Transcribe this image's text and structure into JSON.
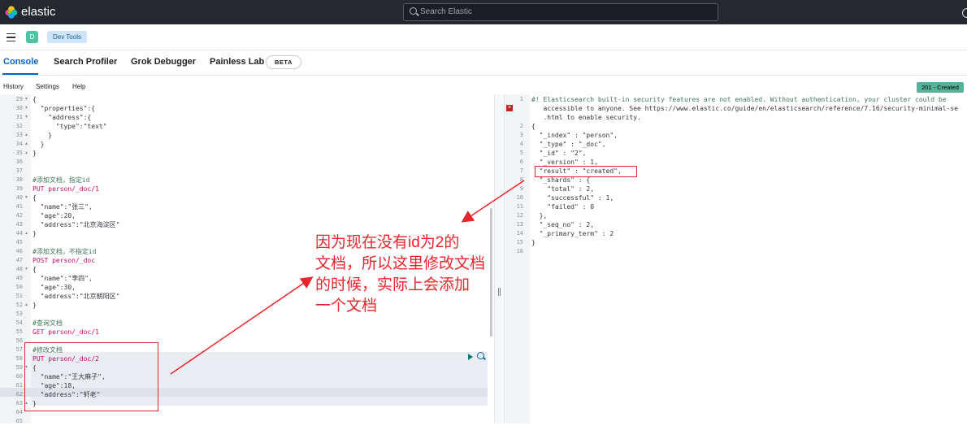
{
  "header": {
    "brand": "elastic",
    "search_placeholder": "Search Elastic",
    "space_initial": "D",
    "breadcrumb": "Dev Tools"
  },
  "tabs": [
    {
      "label": "Console",
      "active": true
    },
    {
      "label": "Search Profiler"
    },
    {
      "label": "Grok Debugger"
    },
    {
      "label": "Painless Lab"
    }
  ],
  "beta_badge": "BETA",
  "toolbar": {
    "history": "History",
    "settings": "Settings",
    "help": "Help"
  },
  "status_badge": "201 - Created",
  "colors": {
    "accent": "#0b64b8",
    "annotation": "#e8252c",
    "status": "#54b399"
  },
  "request_lines": [
    {
      "n": "29",
      "text": "{"
    },
    {
      "n": "30",
      "text": "  \"properties\":{"
    },
    {
      "n": "31",
      "text": "    \"address\":{"
    },
    {
      "n": "32",
      "text": "      \"type\":\"text\""
    },
    {
      "n": "33",
      "text": "    }"
    },
    {
      "n": "34",
      "text": "  }"
    },
    {
      "n": "35",
      "text": "}"
    },
    {
      "n": "36",
      "text": ""
    },
    {
      "n": "37",
      "text": ""
    },
    {
      "n": "38",
      "text": "#添加文档，指定id"
    },
    {
      "n": "39",
      "text": "PUT person/_doc/1"
    },
    {
      "n": "40",
      "text": "{"
    },
    {
      "n": "41",
      "text": "  \"name\":\"张三\","
    },
    {
      "n": "42",
      "text": "  \"age\":20,"
    },
    {
      "n": "43",
      "text": "  \"address\":\"北京海淀区\""
    },
    {
      "n": "44",
      "text": "}"
    },
    {
      "n": "45",
      "text": ""
    },
    {
      "n": "46",
      "text": "#添加文档，不指定id"
    },
    {
      "n": "47",
      "text": "POST person/_doc"
    },
    {
      "n": "48",
      "text": "{"
    },
    {
      "n": "49",
      "text": "  \"name\":\"李四\","
    },
    {
      "n": "50",
      "text": "  \"age\":30,"
    },
    {
      "n": "51",
      "text": "  \"address\":\"北京朝阳区\""
    },
    {
      "n": "52",
      "text": "}"
    },
    {
      "n": "53",
      "text": ""
    },
    {
      "n": "54",
      "text": "#查询文档"
    },
    {
      "n": "55",
      "text": "GET person/_doc/1"
    },
    {
      "n": "56",
      "text": ""
    },
    {
      "n": "57",
      "text": "#修改文档"
    },
    {
      "n": "58",
      "text": "PUT person/_doc/2"
    },
    {
      "n": "59",
      "text": "{"
    },
    {
      "n": "60",
      "text": "  \"name\":\"王大麻子\","
    },
    {
      "n": "61",
      "text": "  \"age\":18,"
    },
    {
      "n": "62",
      "text": "  \"address\":\"轩老\""
    },
    {
      "n": "63",
      "text": "}"
    },
    {
      "n": "64",
      "text": ""
    },
    {
      "n": "65",
      "text": ""
    }
  ],
  "response_lines": [
    {
      "n": "1",
      "text": "#! Elasticsearch built-in security features are not enabled. Without authentication, your cluster could be"
    },
    {
      "n": "",
      "text": "   accessible to anyone. See https://www.elastic.co/guide/en/elasticsearch/reference/7.16/security-minimal-se"
    },
    {
      "n": "",
      "text": "   .html to enable security."
    },
    {
      "n": "2",
      "text": "{"
    },
    {
      "n": "3",
      "text": "  \"_index\" : \"person\","
    },
    {
      "n": "4",
      "text": "  \"_type\" : \"_doc\","
    },
    {
      "n": "5",
      "text": "  \"_id\" : \"2\","
    },
    {
      "n": "6",
      "text": "  \"_version\" : 1,"
    },
    {
      "n": "7",
      "text": "  \"result\" : \"created\","
    },
    {
      "n": "8",
      "text": "  \"_shards\" : {"
    },
    {
      "n": "9",
      "text": "    \"total\" : 2,"
    },
    {
      "n": "10",
      "text": "    \"successful\" : 1,"
    },
    {
      "n": "11",
      "text": "    \"failed\" : 0"
    },
    {
      "n": "12",
      "text": "  },"
    },
    {
      "n": "13",
      "text": "  \"_seq_no\" : 2,"
    },
    {
      "n": "14",
      "text": "  \"_primary_term\" : 2"
    },
    {
      "n": "15",
      "text": "}"
    },
    {
      "n": "16",
      "text": ""
    }
  ],
  "annotation_lines": [
    "因为现在没有id为2的",
    "文档，所以这里修改文档",
    "的时候，实际上会添加",
    "一个文档"
  ]
}
